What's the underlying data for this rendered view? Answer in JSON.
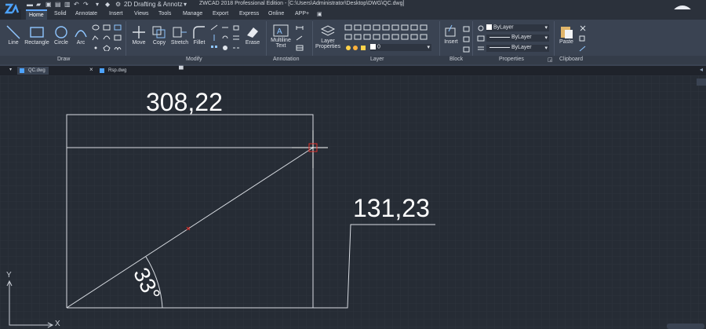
{
  "app": {
    "title": "ZWCAD 2018 Professional Edition - [C:\\Users\\Administrator\\Desktop\\DWG\\QC.dwg]",
    "workspace": "2D Drafting & Annotz",
    "help": "?"
  },
  "tabs": [
    "Home",
    "Solid",
    "Annotate",
    "Insert",
    "Views",
    "Tools",
    "Manage",
    "Export",
    "Express",
    "Online",
    "APP+"
  ],
  "ribbon": {
    "draw": {
      "line": "Line",
      "rectangle": "Rectangle",
      "circle": "Circle",
      "arc": "Arc"
    },
    "modify": {
      "move": "Move",
      "copy": "Copy",
      "stretch": "Stretch",
      "fillet": "Fillet",
      "erase": "Erase"
    },
    "annotation": {
      "multiline_text_1": "Multiline",
      "multiline_text_2": "Text"
    },
    "layer": {
      "properties_1": "Layer",
      "properties_2": "Properties",
      "current_layer": "0"
    },
    "block": {
      "insert": "Insert"
    },
    "properties": {
      "color": "ByLayer",
      "linetype": "ByLayer",
      "lineweight": "ByLayer"
    },
    "clipboard": {
      "paste": "Paste"
    }
  },
  "panels": {
    "draw": "Draw",
    "modify": "Modify",
    "annotation": "Annotation",
    "layer": "Layer",
    "block": "Block",
    "properties": "Properties",
    "clipboard": "Clipboard"
  },
  "documents": [
    "QC.dwg",
    "Rsp.dwg"
  ],
  "drawing": {
    "width_dim": "308,22",
    "height_dim": "131,23",
    "angle_dim": "33°"
  },
  "ucs": {
    "x": "X",
    "y": "Y"
  },
  "colors": {
    "accent": "#61a8ff",
    "canvas": "#262c35",
    "ribbon": "#3a4352",
    "marker": "#e0302a"
  }
}
